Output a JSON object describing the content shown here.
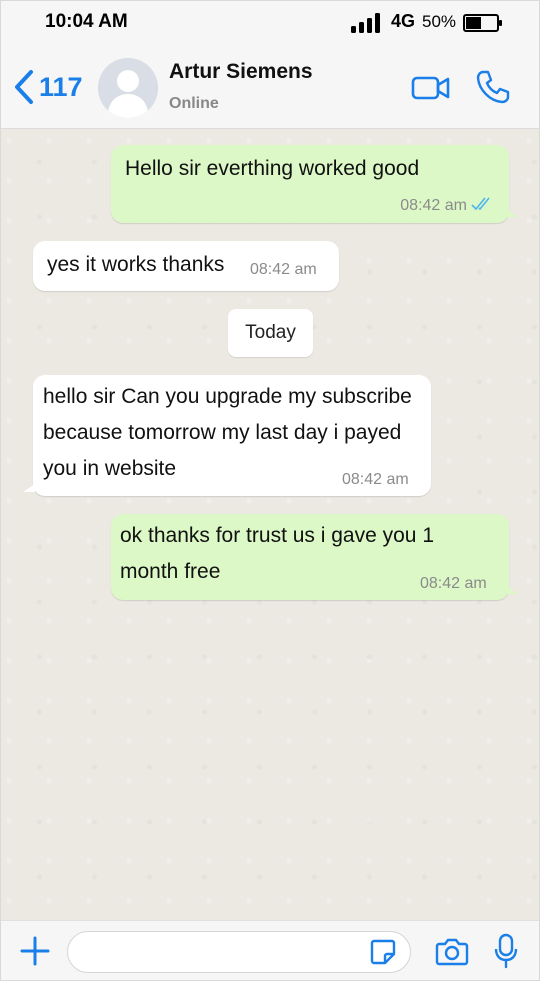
{
  "status_bar": {
    "time": "10:04 AM",
    "network": "4G",
    "battery_percent": "50%",
    "battery_level": 0.5,
    "signal_icon": "signal-bars-icon",
    "battery_icon": "battery-icon"
  },
  "header": {
    "back_count": "117",
    "contact_name": "Artur Siemens",
    "contact_status": "Online",
    "accent_color": "#1a7fe8"
  },
  "messages": [
    {
      "direction": "out",
      "text": "Hello sir everthing worked good",
      "time": "08:42 am",
      "read": true
    },
    {
      "direction": "in",
      "text": "yes it works thanks",
      "time": "08:42 am"
    },
    {
      "direction": "in",
      "text": "hello sir Can you upgrade my subscribe because tomorrow my last day i payed you in website",
      "time": "08:42 am"
    },
    {
      "direction": "out",
      "text": "ok thanks for trust us i gave you 1 month free",
      "time": "08:42 am"
    }
  ],
  "day_separator": "Today",
  "input_bar": {
    "placeholder": "",
    "value": ""
  },
  "colors": {
    "outgoing_bubble": "#dcf8c6",
    "incoming_bubble": "#ffffff",
    "read_ticks": "#4fb6ec"
  }
}
